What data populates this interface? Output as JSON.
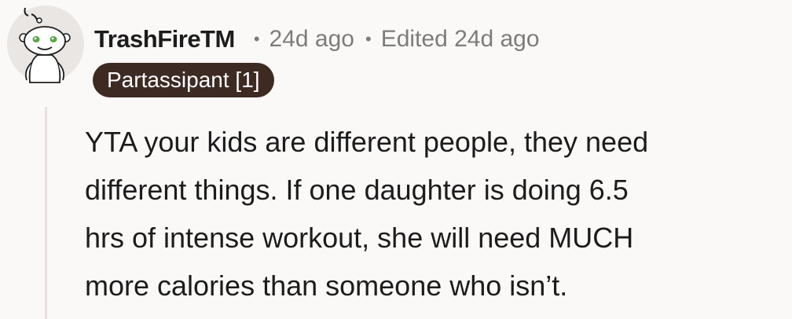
{
  "comment": {
    "username": "TrashFireTM",
    "separator": "•",
    "time": "24d ago",
    "edited": "Edited 24d ago",
    "flair": "Partassipant [1]",
    "body_lines": [
      "YTA your kids are different people, they need",
      "different things. If one daughter is doing 6.5",
      "hrs of intense workout, she will need MUCH",
      "more calories than someone who isn’t."
    ]
  },
  "colors": {
    "background": "#fbf9f8",
    "flair_bg": "#3d2a23",
    "meta_text": "#7c7c7c",
    "body_text": "#1c1c1c",
    "thread_line": "#e7e1de"
  },
  "icons": {
    "avatar": "snoo-avatar-icon"
  }
}
